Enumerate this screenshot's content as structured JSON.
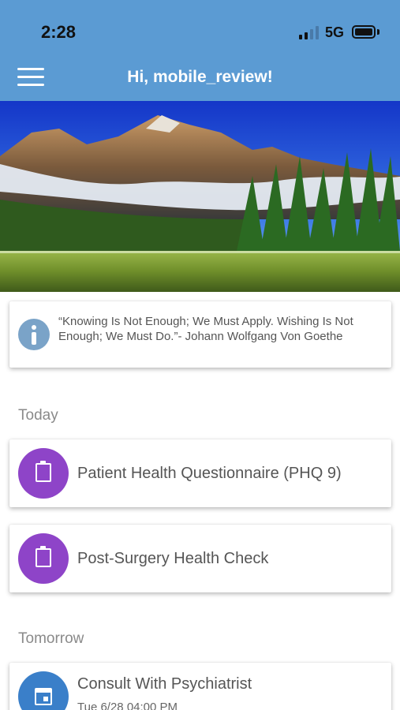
{
  "status_bar": {
    "time": "2:28",
    "network": "5G",
    "signal_bars_active": 2,
    "signal_bars_total": 4,
    "battery_level": 1.0
  },
  "app_bar": {
    "title": "Hi, mobile_review!",
    "menu_icon": "hamburger-menu-icon",
    "background_color": "#5b9bd3"
  },
  "hero": {
    "image": "mountain-lake-landscape"
  },
  "quote": {
    "icon": "info-icon",
    "text": "“Knowing Is Not Enough; We Must Apply. Wishing Is Not Enough; We Must Do.”- Johann Wolfgang Von Goethe"
  },
  "sections": {
    "today": {
      "label": "Today",
      "items": [
        {
          "label": "Patient Health Questionnaire (PHQ 9)",
          "icon": "clipboard-icon",
          "color": "#8e44c8"
        },
        {
          "label": "Post-Surgery Health Check",
          "icon": "clipboard-icon",
          "color": "#8e44c8"
        }
      ]
    },
    "tomorrow": {
      "label": "Tomorrow",
      "items": [
        {
          "label": "Consult With Psychiatrist",
          "sublabel": "Tue 6/28 04:00 PM",
          "icon": "calendar-icon",
          "color": "#3a7fc9"
        }
      ]
    }
  }
}
